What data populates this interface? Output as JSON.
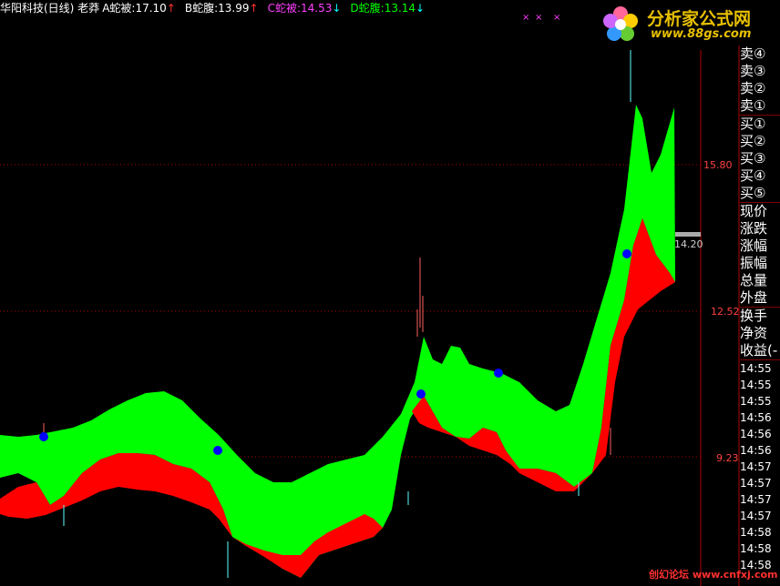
{
  "header": {
    "stock": "华阳科技(日线) 老莽",
    "a_label": "A蛇被:17.10",
    "a_arrow": "↑",
    "b_label": "B蛇腹:13.99",
    "b_arrow": "↑",
    "c_label": "C蛇被:14.53",
    "c_arrow": "↓",
    "d_label": "D蛇腹:13.14",
    "d_arrow": "↓",
    "colors": {
      "stock": "#ffffff",
      "a": "#ffffff",
      "b": "#ffffff",
      "c": "#ff40ff",
      "d": "#00ff00",
      "up": "#ff3030",
      "down": "#00ffff"
    }
  },
  "axis": {
    "ticks": [
      "15.80",
      "12.52",
      "9.23"
    ],
    "last_price": "14.20"
  },
  "sidebar": {
    "items": [
      "卖④",
      "卖③",
      "卖②",
      "卖①",
      "买①",
      "买②",
      "买③",
      "买④",
      "买⑤",
      "现价",
      "涨跌",
      "涨幅",
      "振幅",
      "总量",
      "外盘",
      "换手",
      "净资",
      "收益(-"
    ],
    "times": [
      "14:55",
      "14:55",
      "14:55",
      "14:56",
      "14:56",
      "14:56",
      "14:57",
      "14:57",
      "14:57",
      "14:57",
      "14:58",
      "14:58",
      "14:58"
    ]
  },
  "watermark": {
    "logo_title": "分析家公式网",
    "logo_url": "www.88gs.com",
    "footer": "创幻论坛 www.cnfxj.com"
  },
  "chart_data": {
    "type": "area",
    "ticks": [
      15.8,
      12.52,
      9.23
    ],
    "colors": {
      "upper_band": "#00ff00",
      "lower_band": "#ff0000",
      "grid": "#b00000",
      "marker": "#0000ff",
      "candle_up": "#ff6060",
      "candle_down": "#60ffff"
    }
  }
}
